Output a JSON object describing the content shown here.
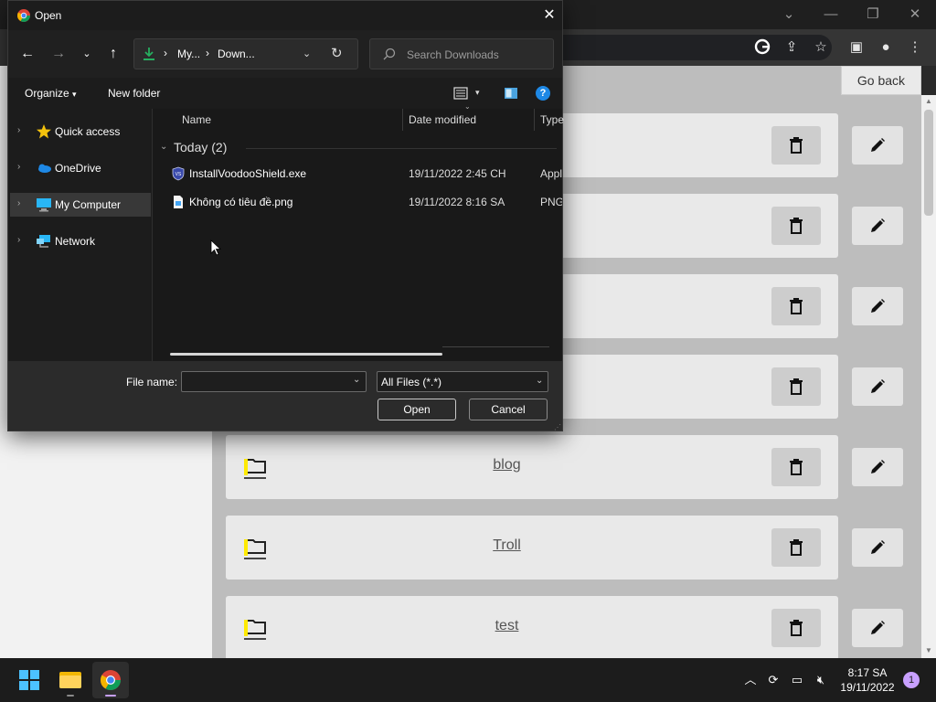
{
  "browser": {
    "go_back_label": "Go back",
    "cards": [
      {
        "name": ""
      },
      {
        "name": ""
      },
      {
        "name": ""
      },
      {
        "name": ""
      },
      {
        "name": "blog"
      },
      {
        "name": "Troll"
      },
      {
        "name": "test"
      }
    ]
  },
  "dialog": {
    "title": "Open",
    "breadcrumbs": [
      "My...",
      "Down..."
    ],
    "search_placeholder": "Search Downloads",
    "organize_label": "Organize",
    "new_folder_label": "New folder",
    "help_glyph": "?",
    "nav_items": [
      {
        "label": "Quick access",
        "icon": "star-icon",
        "selected": false
      },
      {
        "label": "OneDrive",
        "icon": "cloud-icon",
        "selected": false
      },
      {
        "label": "My Computer",
        "icon": "computer-icon",
        "selected": true
      },
      {
        "label": "Network",
        "icon": "network-icon",
        "selected": false
      }
    ],
    "columns": [
      "Name",
      "Date modified",
      "Type"
    ],
    "group_label": "Today (2)",
    "files": [
      {
        "name": "InstallVoodooShield.exe",
        "date": "19/11/2022 2:45 CH",
        "type": "Appli",
        "icon": "shield-exe-icon"
      },
      {
        "name": "Không có tiêu đề.png",
        "date": "19/11/2022 8:16 SA",
        "type": "PNG",
        "icon": "image-file-icon"
      }
    ],
    "file_name_label": "File name:",
    "file_name_value": "",
    "file_type_value": "All Files (*.*)",
    "open_label": "Open",
    "cancel_label": "Cancel"
  },
  "taskbar": {
    "time": "8:17 SA",
    "date": "19/11/2022",
    "notification_count": "1"
  },
  "colors": {
    "accent_blue": "#1e88e5",
    "folder_highlight": "#ffea00",
    "dialog_bg": "#1c1c1c"
  }
}
